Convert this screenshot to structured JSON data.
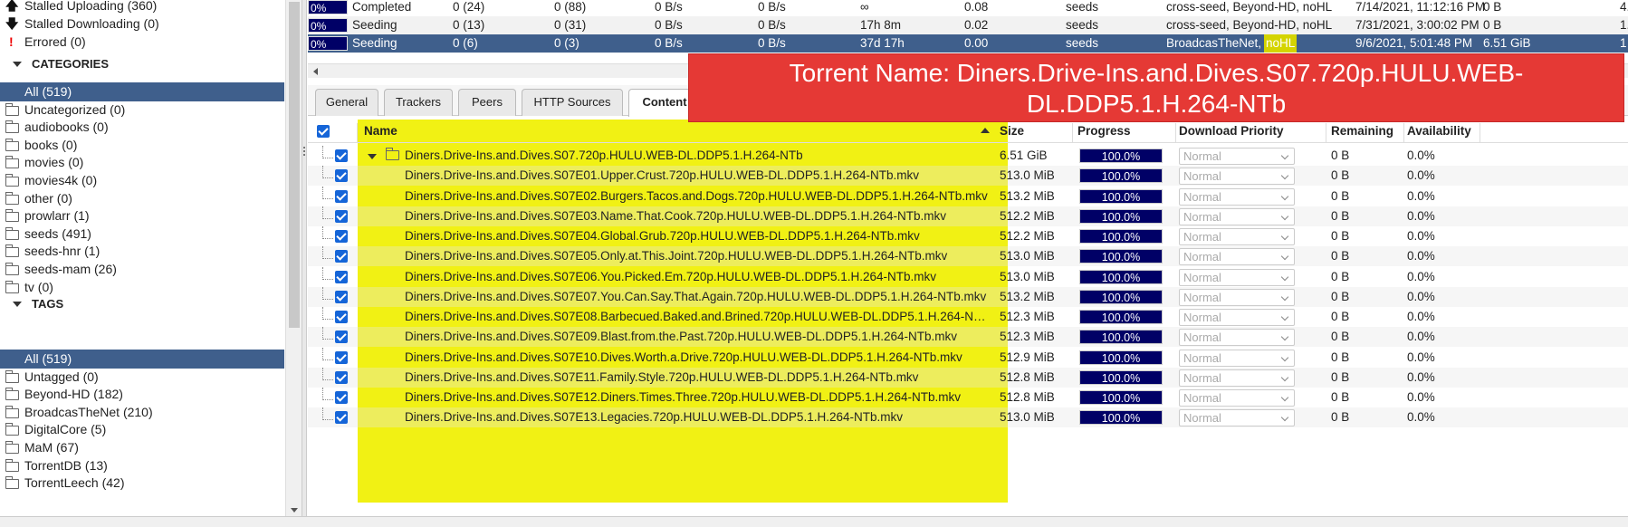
{
  "sidebar": {
    "status_items": [
      {
        "label": "Stalled Uploading (360)",
        "icon": "arrow-up-icon"
      },
      {
        "label": "Stalled Downloading (0)",
        "icon": "arrow-down-icon"
      },
      {
        "label": "Errored (0)",
        "icon": "error-icon"
      }
    ],
    "categories_header": "CATEGORIES",
    "categories": [
      "All (519)",
      "Uncategorized (0)",
      "audiobooks (0)",
      "books (0)",
      "movies (0)",
      "movies4k (0)",
      "other (0)",
      "prowlarr (1)",
      "seeds (491)",
      "seeds-hnr (1)",
      "seeds-mam (26)",
      "tv (0)"
    ],
    "tags_header": "TAGS",
    "tags": [
      "All (519)",
      "Untagged (0)",
      "Beyond-HD (182)",
      "BroadcasTheNet (210)",
      "DigitalCore (5)",
      "MaM (67)",
      "TorrentDB (13)",
      "TorrentLeech (42)"
    ]
  },
  "torrents": [
    {
      "progress": "0%",
      "state": "Completed",
      "seeds": "0 (24)",
      "peers": "0 (88)",
      "down": "0 B/s",
      "up": "0 B/s",
      "eta": "∞",
      "ratio": "0.08",
      "category": "seeds",
      "tags": "cross-seed, Beyond-HD, noHL",
      "added": "7/14/2021, 11:12:16 PM",
      "size": "0 B",
      "extra": "4."
    },
    {
      "progress": "0%",
      "state": "Seeding",
      "seeds": "0 (13)",
      "peers": "0 (31)",
      "down": "0 B/s",
      "up": "0 B/s",
      "eta": "17h 8m",
      "ratio": "0.02",
      "category": "seeds",
      "tags": "cross-seed, Beyond-HD, noHL",
      "added": "7/31/2021, 3:00:02 PM",
      "size": "0 B",
      "extra": "1."
    },
    {
      "progress": "0%",
      "state": "Seeding",
      "seeds": "0 (6)",
      "peers": "0 (3)",
      "down": "0 B/s",
      "up": "0 B/s",
      "eta": "37d 17h",
      "ratio": "0.00",
      "category": "seeds",
      "tags": "BroadcasTheNet, ",
      "tags_hl": "noHL",
      "added": "9/6/2021, 5:01:48 PM",
      "size": "6.51 GiB",
      "extra": "1"
    }
  ],
  "tabs": [
    "General",
    "Trackers",
    "Peers",
    "HTTP Sources",
    "Content"
  ],
  "overlay_text": "Torrent Name: Diners.Drive-Ins.and.Dives.S07.720p.HULU.WEB-DL.DDP5.1.H.264-NTb",
  "content": {
    "headers": {
      "name": "Name",
      "size": "Size",
      "progress": "Progress",
      "priority": "Download Priority",
      "remaining": "Remaining",
      "availability": "Availability"
    },
    "folder": {
      "name": "Diners.Drive-Ins.and.Dives.S07.720p.HULU.WEB-DL.DDP5.1.H.264-NTb",
      "size": "6.51 GiB",
      "progress": "100.0%",
      "priority": "Normal",
      "remaining": "0 B",
      "availability": "0.0%"
    },
    "files": [
      {
        "name": "Diners.Drive-Ins.and.Dives.S07E01.Upper.Crust.720p.HULU.WEB-DL.DDP5.1.H.264-NTb.mkv",
        "size": "513.0 MiB"
      },
      {
        "name": "Diners.Drive-Ins.and.Dives.S07E02.Burgers.Tacos.and.Dogs.720p.HULU.WEB-DL.DDP5.1.H.264-NTb.mkv",
        "size": "513.2 MiB"
      },
      {
        "name": "Diners.Drive-Ins.and.Dives.S07E03.Name.That.Cook.720p.HULU.WEB-DL.DDP5.1.H.264-NTb.mkv",
        "size": "512.2 MiB"
      },
      {
        "name": "Diners.Drive-Ins.and.Dives.S07E04.Global.Grub.720p.HULU.WEB-DL.DDP5.1.H.264-NTb.mkv",
        "size": "512.2 MiB"
      },
      {
        "name": "Diners.Drive-Ins.and.Dives.S07E05.Only.at.This.Joint.720p.HULU.WEB-DL.DDP5.1.H.264-NTb.mkv",
        "size": "513.0 MiB"
      },
      {
        "name": "Diners.Drive-Ins.and.Dives.S07E06.You.Picked.Em.720p.HULU.WEB-DL.DDP5.1.H.264-NTb.mkv",
        "size": "513.0 MiB"
      },
      {
        "name": "Diners.Drive-Ins.and.Dives.S07E07.You.Can.Say.That.Again.720p.HULU.WEB-DL.DDP5.1.H.264-NTb.mkv",
        "size": "513.2 MiB"
      },
      {
        "name": "Diners.Drive-Ins.and.Dives.S07E08.Barbecued.Baked.and.Brined.720p.HULU.WEB-DL.DDP5.1.H.264-N…",
        "size": "512.3 MiB"
      },
      {
        "name": "Diners.Drive-Ins.and.Dives.S07E09.Blast.from.the.Past.720p.HULU.WEB-DL.DDP5.1.H.264-NTb.mkv",
        "size": "512.3 MiB"
      },
      {
        "name": "Diners.Drive-Ins.and.Dives.S07E10.Dives.Worth.a.Drive.720p.HULU.WEB-DL.DDP5.1.H.264-NTb.mkv",
        "size": "512.9 MiB"
      },
      {
        "name": "Diners.Drive-Ins.and.Dives.S07E11.Family.Style.720p.HULU.WEB-DL.DDP5.1.H.264-NTb.mkv",
        "size": "512.8 MiB"
      },
      {
        "name": "Diners.Drive-Ins.and.Dives.S07E12.Diners.Times.Three.720p.HULU.WEB-DL.DDP5.1.H.264-NTb.mkv",
        "size": "512.8 MiB"
      },
      {
        "name": "Diners.Drive-Ins.and.Dives.S07E13.Legacies.720p.HULU.WEB-DL.DDP5.1.H.264-NTb.mkv",
        "size": "513.0 MiB"
      }
    ],
    "file_progress": "100.0%",
    "file_priority": "Normal",
    "file_remaining": "0 B",
    "file_availability": "0.0%"
  },
  "colors": {
    "selected": "#3f5f8c",
    "progress": "#000066",
    "highlight": "#f0f000",
    "overlay": "#e53935",
    "checkbox": "#1565d8"
  }
}
